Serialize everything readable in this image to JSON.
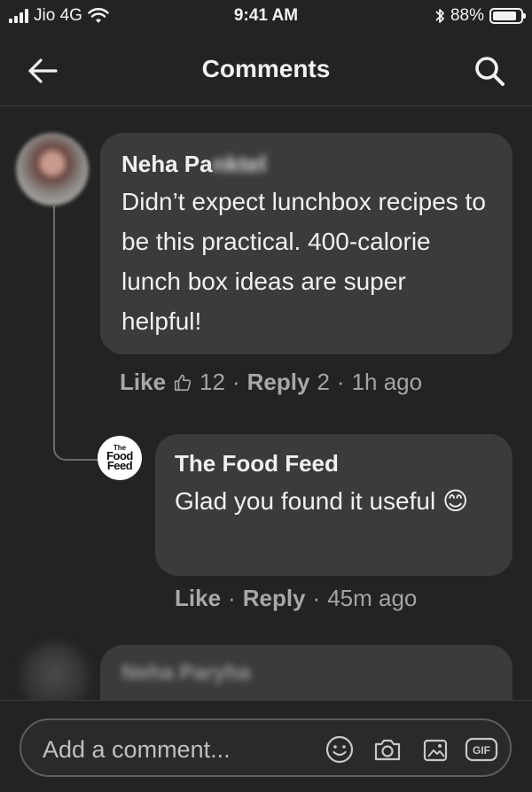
{
  "status_bar": {
    "carrier": "Jio 4G",
    "time": "9:41 AM",
    "battery": "88%",
    "battery_level": 0.88
  },
  "header": {
    "title": "Comments",
    "back_icon": "arrow-left-icon",
    "search_icon": "search-icon"
  },
  "comments": [
    {
      "author_visible": "Neha Pa",
      "author_blurred": "nktel",
      "text": "Didn’t expect lunchbox recipes to be this practical. 400-calorie lunch box ideas are super helpful!",
      "like_label": "Like",
      "like_count": "12",
      "reply_label": "Reply",
      "reply_count": "2",
      "time": "1h ago"
    },
    {
      "author": "The Food Feed",
      "avatar_small": "The",
      "avatar_line1": "Food",
      "avatar_line2": "Feed",
      "text": "Glad you found it useful 😊",
      "like_label": "Like",
      "reply_label": "Reply",
      "time": "45m ago"
    },
    {
      "author": "Neha Paryha"
    }
  ],
  "composer": {
    "placeholder": "Add a comment...",
    "gif_label": "GIF"
  },
  "colors": {
    "background": "#232323",
    "bubble": "#3b3b3d",
    "text": "#f0f0f0",
    "muted": "#a4a4a4"
  }
}
